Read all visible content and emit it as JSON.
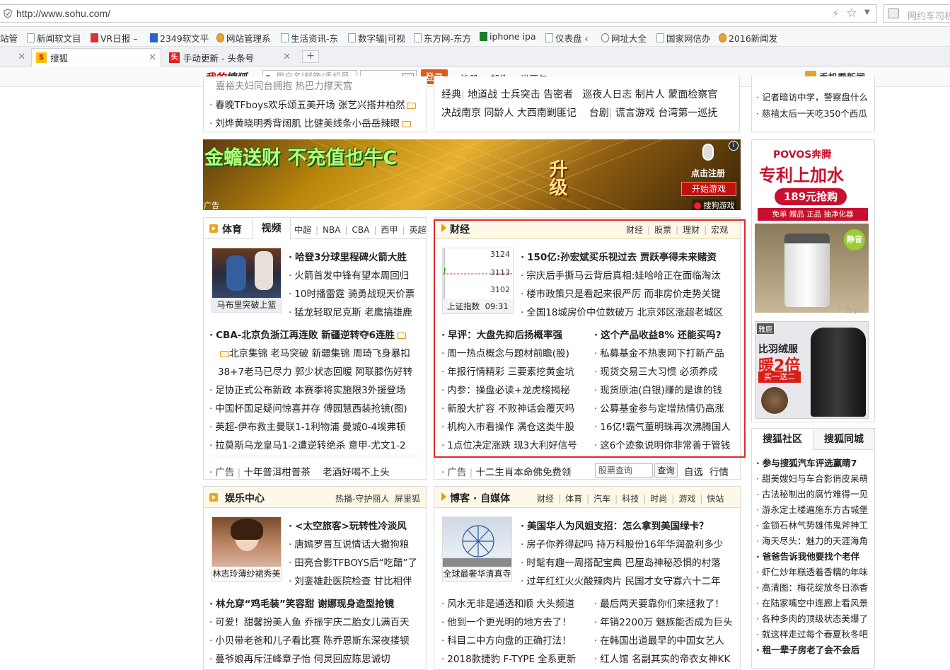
{
  "browser": {
    "url": "http://www.sohu.com/",
    "search_placeholder": "网约车司机",
    "bookmarks": [
      "站管",
      "新闻软文目",
      "VR日报 –",
      "2349软文平",
      "网站管理系",
      "生活资讯-东",
      "数字辐|可视",
      "东方网-东方",
      "iphone ipa",
      "仪表盘 ‹",
      "网址大全",
      "国家网信办",
      "2016新闻发"
    ],
    "tabs": [
      {
        "label": "搜狐",
        "favicon": "S"
      },
      {
        "label": "手动更新 - 头条号",
        "favicon": "头"
      }
    ],
    "new_tab": "+"
  },
  "login": {
    "logo_prefix": "我的",
    "logo_suffix": "搜狐",
    "user_placeholder": "用户名|邮箱/手机号",
    "login_button": "登录",
    "links": [
      "注册",
      "邮件",
      "说两句"
    ],
    "mobile_news": "手机看新闻"
  },
  "top_left_news": [
    "春晚TFboys欢乐颂五美开场 张艺兴搭井柏然",
    "刘烨黄晓明秀背阔肌 比健美线条小岳岳辣眼"
  ],
  "top_left_cut": "嘉裕夫妇同台拥抱 热巴力撑天宫",
  "top_mid_rows": [
    [
      "经典",
      "地道战",
      "士兵突击",
      "告密者",
      "巡夜人日志",
      "制片人",
      "蒙面检察官"
    ],
    [
      "决战南京",
      "同龄人",
      "大西南剿匪记",
      "台剧",
      "谎言游戏",
      "台湾第一巡抚"
    ]
  ],
  "top_right_news": [
    "记者暗访中学，警察盘什么",
    "慈禧太后一天吃350个西瓜"
  ],
  "banner": {
    "text": "金蟾送财 不充值也牛C",
    "upgrade": "升级",
    "click": "点击注册",
    "start": "开始游戏",
    "ad": "广告",
    "brand": "搜狗游戏"
  },
  "sports": {
    "tabs": [
      "体育",
      "视频"
    ],
    "sub": [
      "中超",
      "NBA",
      "CBA",
      "西甲",
      "英超"
    ],
    "thumb_caption": "马布里突破上篮",
    "thumb_news": [
      "哈登3分球里程碑火箭大胜",
      "火箭首发中锋有望本周回归",
      "10时播雷霆 骑勇战现天价票",
      "猛龙轻取尼克斯 老鹰搞雄鹿"
    ],
    "headline": "CBA-北京负浙江再连败 新疆逆转夺6连胜",
    "news": [
      "北京集锦 老马突破 新疆集锦 周琦飞身暴扣",
      "38+7老马已尽力 郭少状态回暖 阿联膝伤好转",
      "足协正式公布新政 本赛季将实施限3外援登场",
      "中国杯国足疑问惊喜并存 傅园慧西装抢镜(图)",
      "英超-伊布救主曼联1-1利物浦 曼城0-4埃弗顿",
      "拉莫斯乌龙皇马1-2遭逆转绝杀 意甲-尤文1-2"
    ],
    "ad": [
      "广告",
      "十年普洱柑普茶",
      "老酒好喝不上头"
    ]
  },
  "finance": {
    "title": "财经",
    "sub": [
      "财经",
      "股票",
      "理财",
      "宏观"
    ],
    "chart": {
      "y_labels": [
        "3124",
        "3113",
        "3102"
      ],
      "caption": "上证指数",
      "time": "09:31"
    },
    "top_news": [
      "150亿:孙宏斌买乐视过去 贾跃亭得未来赌资",
      "宗庆后手撕马云背后真相:娃哈哈正在面临淘汰",
      "楼市政策只是看起来很严厉 而非房价走势关键",
      "全国18城房价中位数破万 北京郊区涨超老城区"
    ],
    "left_head": "早评：大盘先抑后扬概率强",
    "left": [
      "周一热点概念与题材前瞻(股)",
      "年报行情精彩 三要素挖黄金坑",
      "内参：操盘必读+龙虎榜揭秘",
      "新股大扩容 不败神话会覆灭吗",
      "机构入市看操作 满仓这类牛股",
      "1点位决定涨跌 现3大利好信号"
    ],
    "right_head": "这个产品收益8% 还能买吗?",
    "right": [
      "私募基金不热衷网下打新产品",
      "现货交易三大习惯 必须养成",
      "现货原油(白银)赚的是谁的钱",
      "公募基金参与定增热情仍高涨",
      "16亿!霸气董明珠再次沸腾国人",
      "这6个迹象说明你非常善于管钱"
    ],
    "ad": [
      "广告",
      "十二生肖本命佛免费领"
    ],
    "stock_placeholder": "股票查询",
    "stock_btn": "查询",
    "stock_links": [
      "自选",
      "行情"
    ]
  },
  "ent": {
    "title": "娱乐中心",
    "sub": [
      "热播-守护丽人",
      "屏里狐"
    ],
    "thumb_caption": "林志玲薄纱裙秀美",
    "thumb_news": [
      "<太空旅客>玩转性冷淡风",
      "唐嫣罗晋互说情话大撒狗粮",
      "田亮合影TFBOYS后“吃醋”了",
      "刘銮雄赴医院检查 甘比相伴"
    ],
    "headline": "林允穿“鸡毛装”笑容甜 谢娜现身造型抢镜",
    "news": [
      "可爱！甜馨扮美人鱼 乔振宇庆二胎女儿满百天",
      "小贝带老爸和儿子看比赛 陈乔恩斯东深夜搂钡",
      "蔓爷娘再斥汪峰章子怡 何炅回应陈思诚切"
    ]
  },
  "blog": {
    "title": "博客 · 自媒体",
    "sub": [
      "财经",
      "体育",
      "汽车",
      "科技",
      "时尚",
      "游戏",
      "快站"
    ],
    "thumb_caption": "全球最奢华清真寺",
    "thumb_news": [
      "美国华人为风姐支招：怎么拿到美国绿卡？",
      "房子你养得起吗 持万科股份16年华润盈利多少",
      "时髦有趣一周搭配宝典 巴厘岛神秘恐惧的村落",
      "过年红红火火酸辣肉片 民国才女守寡六十二年"
    ],
    "left": [
      "风水无非是通透和顺 大头频道",
      "他到一个更光明的地方去了！",
      "科目二中方向盘的正确打法！",
      "2018款捷豹 F-TYPE 全系更新"
    ],
    "right": [
      "最后两天要靠你们来拯救了！",
      "年销2200万 魅族能否成为巨头",
      "在韩国出道最早的中国女艺人",
      "红人馆 名副其实的帝衣女神KK"
    ]
  },
  "right_ads": {
    "povos_brand": "POVOS奔腾",
    "povos_line1": "专利上加水",
    "povos_price": "189元抢购",
    "povos_sub": "免单 赠品 正品 抽净化器",
    "povos_tag": "静音",
    "ad_label": "广告",
    "ad_label2": "JD",
    "jacket_tag": "比羽绒服",
    "jacket_big": "暖2倍",
    "jacket_small": "买一送二",
    "jacket_shop": "雅鹿"
  },
  "community": {
    "tabs": [
      "搜狐社区",
      "搜狐同城"
    ],
    "items": [
      "参与搜狐汽车评选赢睛7",
      "甜美嫂妇与车合影俏皮呆萌",
      "古法秘制出的腐竹难得一见",
      "游永定土楼遍施东方古城堡",
      "金锁石林气势雄伟鬼斧神工",
      "海天尽头：魅力的天涯海角",
      "爸爸告诉我他要找个老伴",
      "虾仁炒年糕透着香糯的年味",
      "高清图：梅花绽放冬日添香",
      "在陆家嘴空中连廊上看风景",
      "各种多肉的顶级状态美爆了",
      "就这样走过每个春夏秋冬吧",
      "租一辈子房老了会不会后"
    ]
  }
}
